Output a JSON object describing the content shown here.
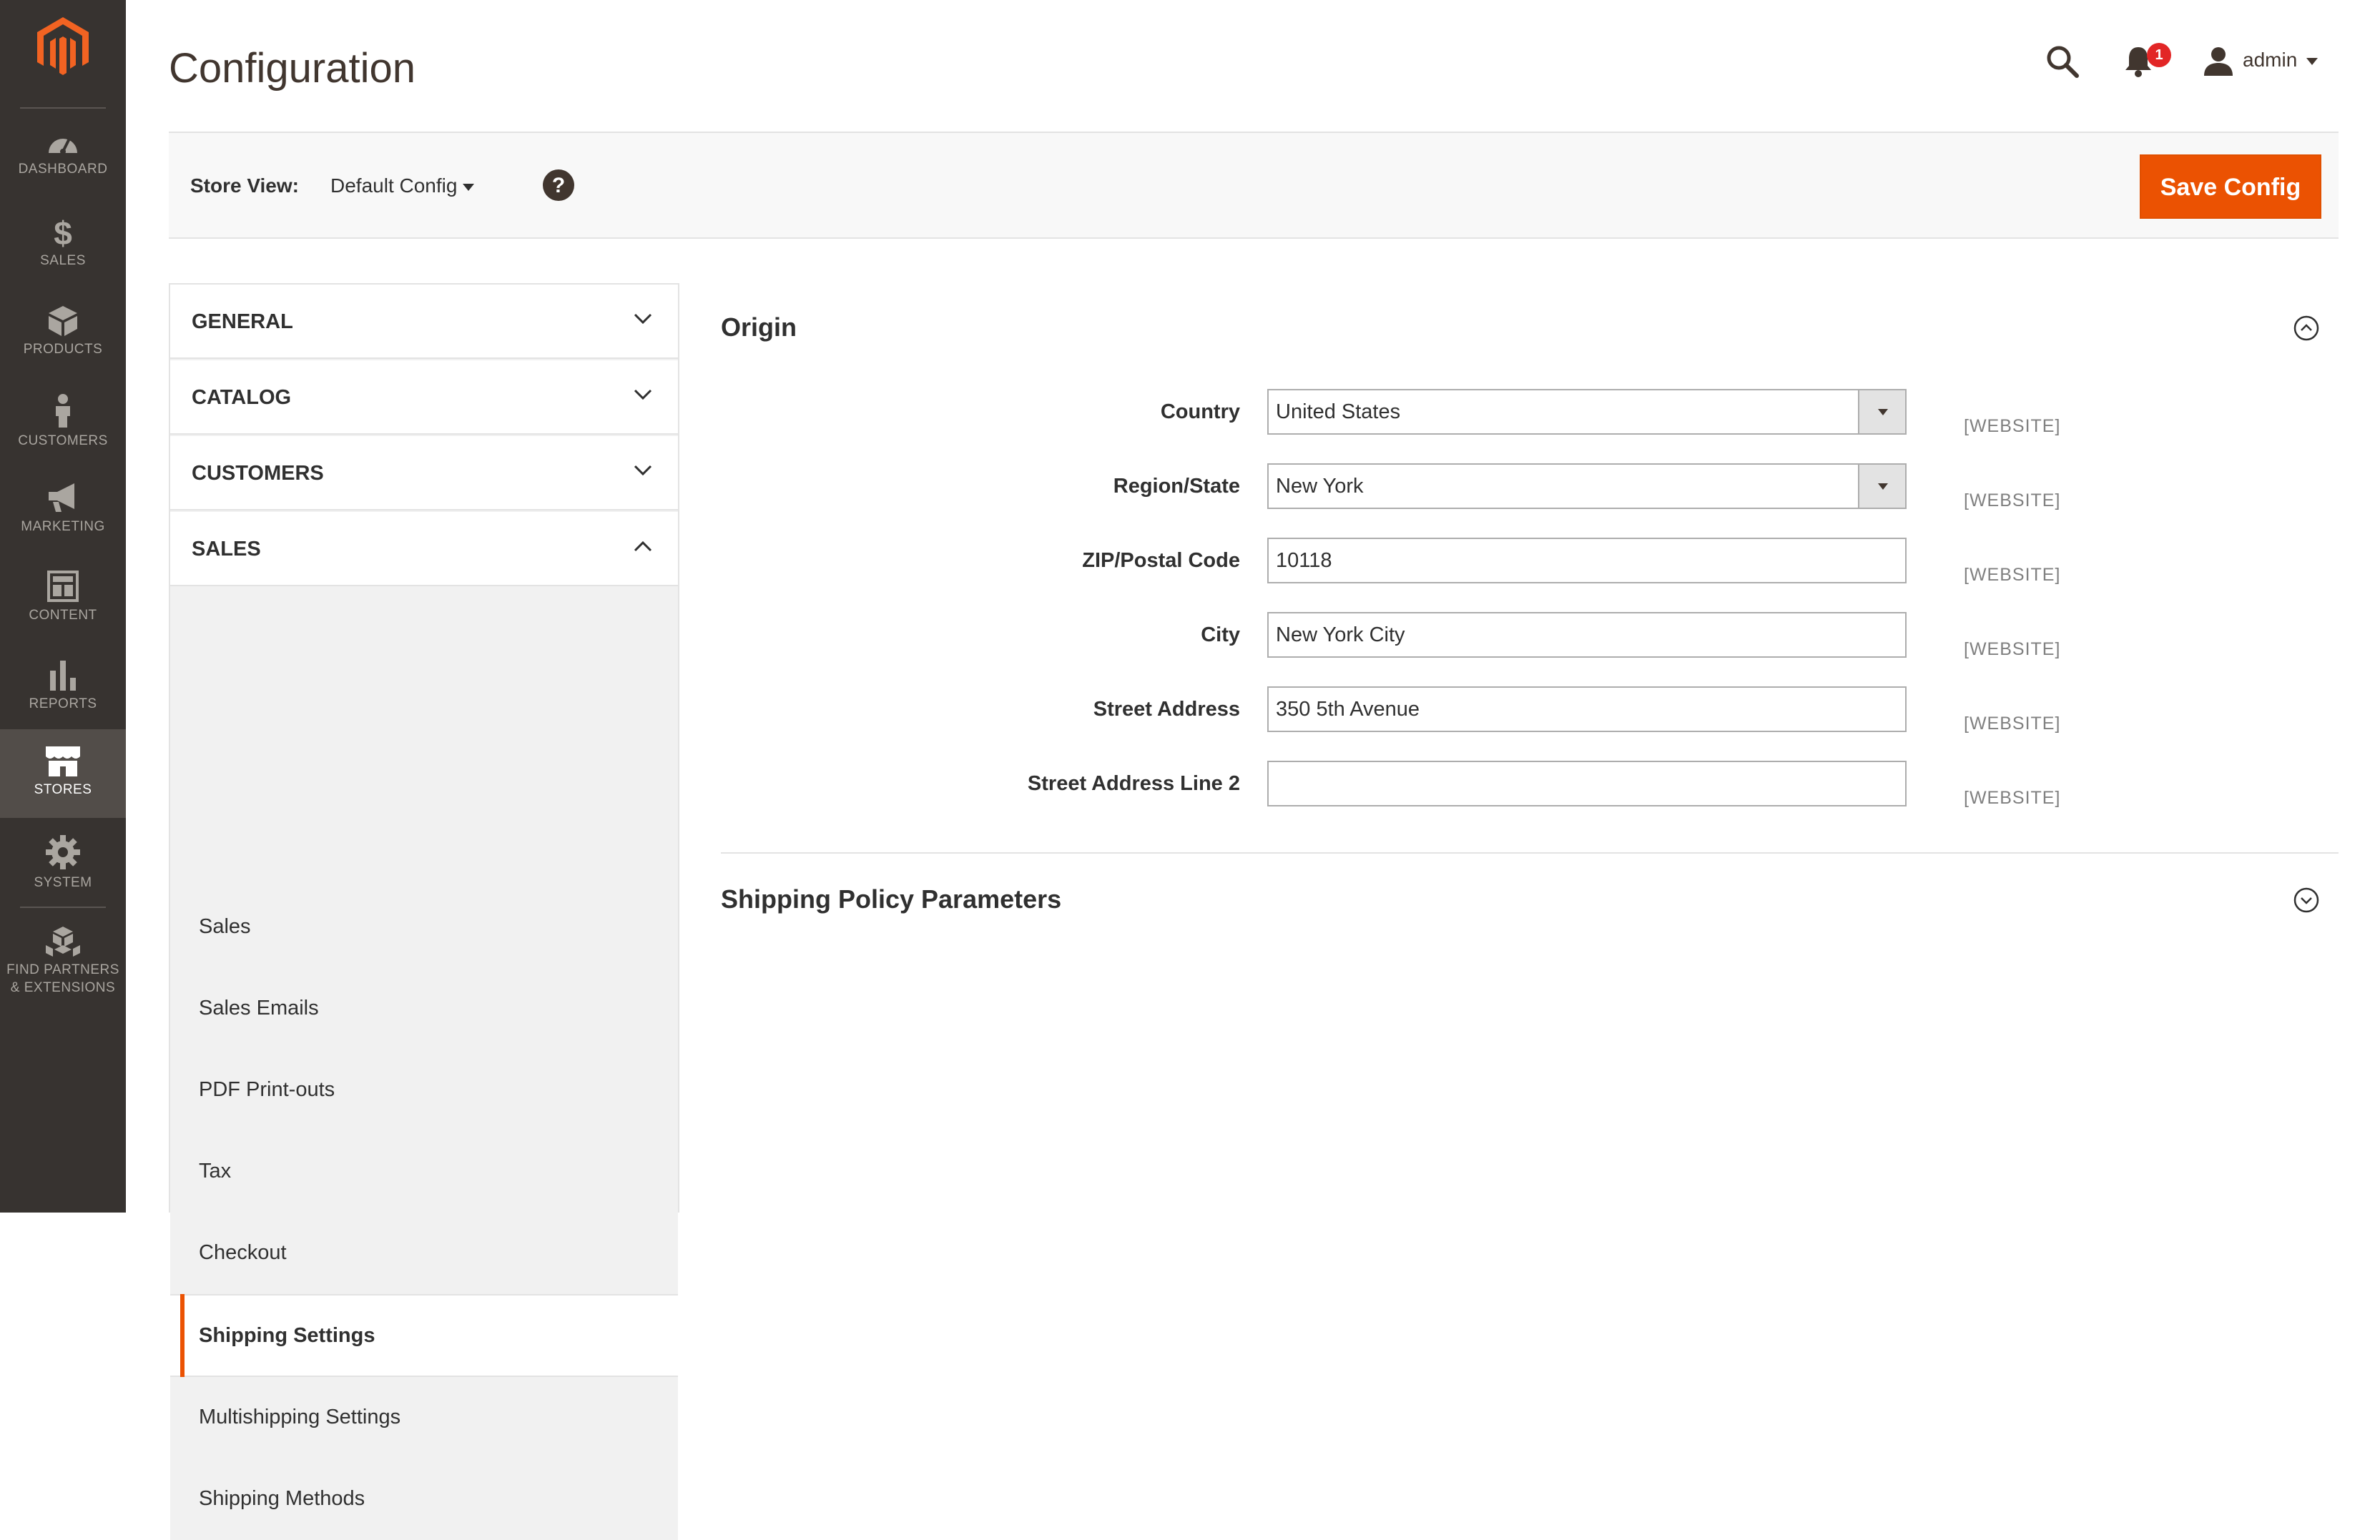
{
  "nav": {
    "items": [
      {
        "label": "Dashboard",
        "icon": "dashboard-icon"
      },
      {
        "label": "Sales",
        "icon": "dollar-icon"
      },
      {
        "label": "Products",
        "icon": "box-icon"
      },
      {
        "label": "Customers",
        "icon": "person-icon"
      },
      {
        "label": "Marketing",
        "icon": "megaphone-icon"
      },
      {
        "label": "Content",
        "icon": "layout-icon"
      },
      {
        "label": "Reports",
        "icon": "bar-chart-icon"
      },
      {
        "label": "Stores",
        "icon": "storefront-icon"
      },
      {
        "label": "System",
        "icon": "gear-icon"
      },
      {
        "label": "Find Partners",
        "label2": "& Extensions",
        "icon": "cubes-icon"
      }
    ],
    "active": "Stores"
  },
  "header": {
    "title": "Configuration",
    "notification_count": "1",
    "username": "admin"
  },
  "store_view": {
    "label": "Store View:",
    "value": "Default Config",
    "save_label": "Save Config"
  },
  "tabs": {
    "groups": [
      "General",
      "Catalog",
      "Customers",
      "Sales"
    ],
    "sales_items": [
      "Sales",
      "Sales Emails",
      "PDF Print-outs",
      "Tax",
      "Checkout",
      "Shipping Settings",
      "Multishipping Settings",
      "Shipping Methods"
    ],
    "active_item": "Shipping Settings"
  },
  "origin": {
    "title": "Origin",
    "scope": "[WEBSITE]",
    "fields": [
      {
        "label": "Country",
        "value": "United States",
        "type": "select"
      },
      {
        "label": "Region/State",
        "value": "New York",
        "type": "select"
      },
      {
        "label": "ZIP/Postal Code",
        "value": "10118",
        "type": "text"
      },
      {
        "label": "City",
        "value": "New York City",
        "type": "text"
      },
      {
        "label": "Street Address",
        "value": "350 5th Avenue",
        "type": "text"
      },
      {
        "label": "Street Address Line 2",
        "value": "",
        "type": "text"
      }
    ]
  },
  "shipping_policy": {
    "title": "Shipping Policy Parameters"
  },
  "colors": {
    "accent": "#eb5202",
    "nav_bg": "#373330",
    "nav_active": "#524d49",
    "badge": "#e22626"
  }
}
